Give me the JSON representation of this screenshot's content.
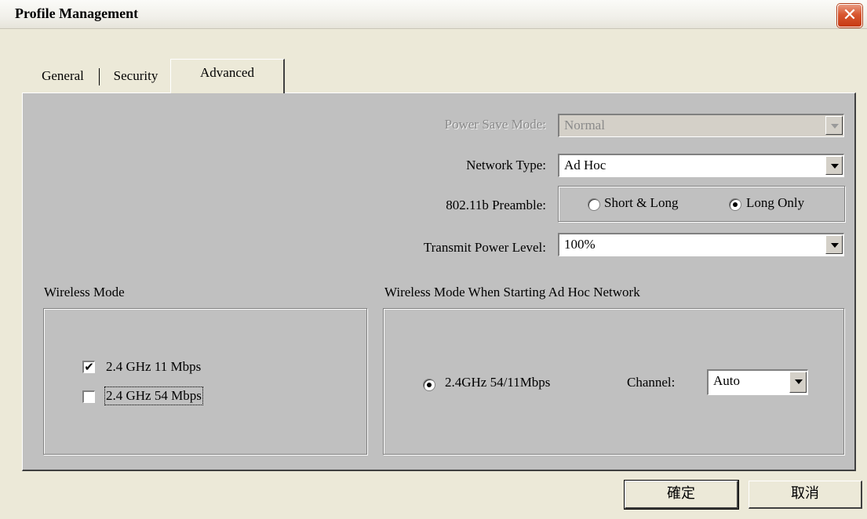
{
  "window": {
    "title": "Profile Management",
    "close_symbol": "✕"
  },
  "tabs": [
    {
      "label": "General",
      "active": false
    },
    {
      "label": "Security",
      "active": false
    },
    {
      "label": "Advanced",
      "active": true
    }
  ],
  "advanced": {
    "power_save_mode": {
      "label": "Power Save Mode:",
      "value": "Normal",
      "enabled": false
    },
    "network_type": {
      "label": "Network Type:",
      "value": "Ad Hoc"
    },
    "preamble": {
      "label": "802.11b Preamble:",
      "options": [
        {
          "label": "Short & Long",
          "selected": false
        },
        {
          "label": "Long Only",
          "selected": true
        }
      ]
    },
    "transmit_power": {
      "label": "Transmit Power Level:",
      "value": "100%"
    },
    "wireless_mode": {
      "title": "Wireless Mode",
      "options": [
        {
          "label": "2.4 GHz 11 Mbps",
          "checked": true
        },
        {
          "label": "2.4 GHz 54 Mbps",
          "checked": false
        }
      ]
    },
    "adhoc_mode": {
      "title": "Wireless Mode When Starting Ad Hoc Network",
      "option": {
        "label": "2.4GHz 54/11Mbps",
        "selected": true
      },
      "channel_label": "Channel:",
      "channel_value": "Auto"
    }
  },
  "buttons": {
    "ok": "確定",
    "cancel": "取消"
  }
}
